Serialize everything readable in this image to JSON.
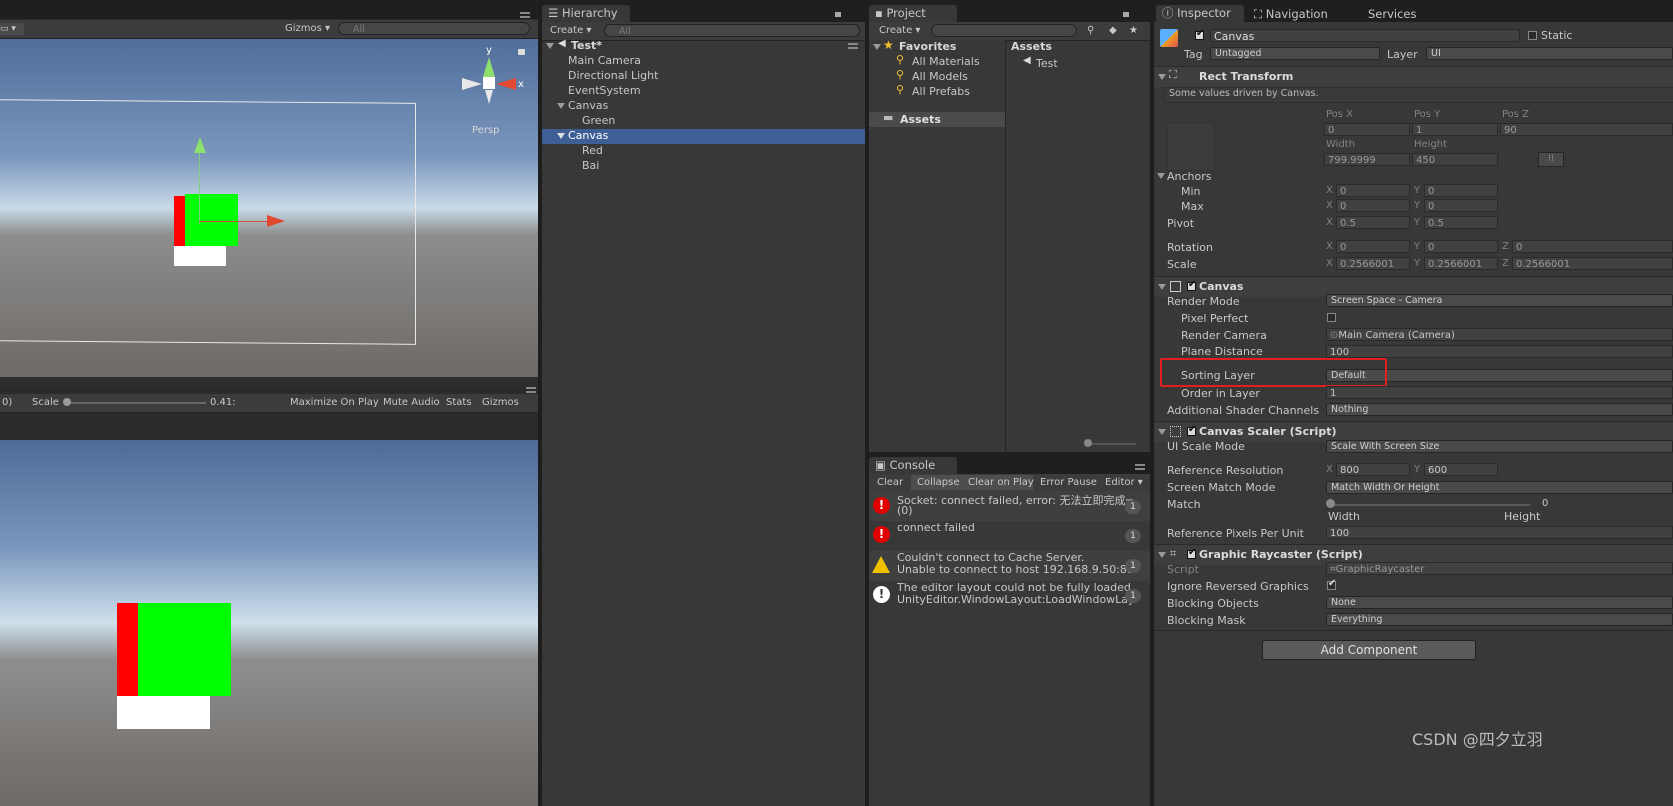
{
  "scene_view": {
    "gizmos_label": "Gizmos ▾",
    "search_placeholder": "All",
    "persp_label": "Persp",
    "axis_x": "x",
    "axis_y": "y"
  },
  "game_view": {
    "display_label": "0)",
    "scale_label": "Scale",
    "scale_value": "0.41:",
    "maximize_label": "Maximize On Play",
    "mute_label": "Mute Audio",
    "stats_label": "Stats",
    "gizmos_label": "Gizmos"
  },
  "hierarchy": {
    "tab_label": "Hierarchy",
    "create_label": "Create ▾",
    "search_placeholder": "All",
    "scene_name": "Test*",
    "items": [
      "Main Camera",
      "Directional Light",
      "EventSystem",
      "Canvas",
      "Green",
      "Canvas",
      "Red",
      "Bai"
    ]
  },
  "project": {
    "tab_label": "Project",
    "create_label": "Create ▾",
    "favorites_label": "Favorites",
    "favorites": [
      "All Materials",
      "All Models",
      "All Prefabs"
    ],
    "assets_folder": "Assets",
    "assets_header": "Assets",
    "asset_items": [
      "Test"
    ]
  },
  "console": {
    "tab_label": "Console",
    "buttons": [
      "Clear",
      "Collapse",
      "Clear on Play",
      "Error Pause",
      "Editor ▾"
    ],
    "logs": [
      {
        "line1": "Socket: connect failed, error: 无法立即完成一非",
        "line2": "(0)",
        "count": "1",
        "kind": "error"
      },
      {
        "line1": "connect failed",
        "line2": "",
        "count": "1",
        "kind": "error"
      },
      {
        "line1": "Couldn't connect to Cache Server.",
        "line2": "Unable to connect to host 192.168.9.50:8126",
        "count": "1",
        "kind": "warning"
      },
      {
        "line1": "The editor layout could not be fully loaded, this",
        "line2": "UnityEditor.WindowLayout:LoadWindowLayout(S",
        "count": "1",
        "kind": "info"
      }
    ]
  },
  "inspector": {
    "tabs": [
      "Inspector",
      "Navigation",
      "Services"
    ],
    "object_name": "Canvas",
    "static_label": "Static",
    "tag_label": "Tag",
    "tag_value": "Untagged",
    "layer_label": "Layer",
    "layer_value": "UI",
    "rect": {
      "title": "Rect Transform",
      "note": "Some values driven by Canvas.",
      "posx_label": "Pos X",
      "posy_label": "Pos Y",
      "posz_label": "Pos Z",
      "posx": "0",
      "posy": "1",
      "posz": "90",
      "width_label": "Width",
      "height_label": "Height",
      "width": "799.9999",
      "height": "450",
      "anchors_label": "Anchors",
      "min_label": "Min",
      "max_label": "Max",
      "min_x": "0",
      "min_y": "0",
      "max_x": "0",
      "max_y": "0",
      "pivot_label": "Pivot",
      "pivot_x": "0.5",
      "pivot_y": "0.5",
      "rotation_label": "Rotation",
      "rot_x": "0",
      "rot_y": "0",
      "rot_z": "0",
      "scale_label": "Scale",
      "scale_x": "0.2566001",
      "scale_y": "0.2566001",
      "scale_z": "0.2566001"
    },
    "canvas": {
      "title": "Canvas",
      "render_mode_label": "Render Mode",
      "render_mode": "Screen Space - Camera",
      "pixel_perfect_label": "Pixel Perfect",
      "render_camera_label": "Render Camera",
      "render_camera": "Main Camera (Camera)",
      "plane_distance_label": "Plane Distance",
      "plane_distance": "100",
      "sorting_layer_label": "Sorting Layer",
      "sorting_layer": "Default",
      "order_label": "Order in Layer",
      "order": "1",
      "shader_label": "Additional Shader Channels",
      "shader": "Nothing"
    },
    "scaler": {
      "title": "Canvas Scaler (Script)",
      "ui_scale_label": "UI Scale Mode",
      "ui_scale": "Scale With Screen Size",
      "ref_res_label": "Reference Resolution",
      "ref_x": "800",
      "ref_y": "600",
      "match_mode_label": "Screen Match Mode",
      "match_mode": "Match Width Or Height",
      "match_label": "Match",
      "match_value": "0",
      "match_left": "Width",
      "match_right": "Height",
      "ppu_label": "Reference Pixels Per Unit",
      "ppu": "100"
    },
    "raycaster": {
      "title": "Graphic Raycaster (Script)",
      "script_label": "Script",
      "script": "GraphicRaycaster",
      "ignore_label": "Ignore Reversed Graphics",
      "blocking_objects_label": "Blocking Objects",
      "blocking_objects": "None",
      "blocking_mask_label": "Blocking Mask",
      "blocking_mask": "Everything"
    },
    "add_component": "Add Component"
  },
  "watermark": "CSDN @四夕立羽",
  "colors": {
    "highlight_box": "#e02020",
    "selection": "#3e5f96",
    "green": "#00ff00",
    "red": "#ff0000"
  }
}
